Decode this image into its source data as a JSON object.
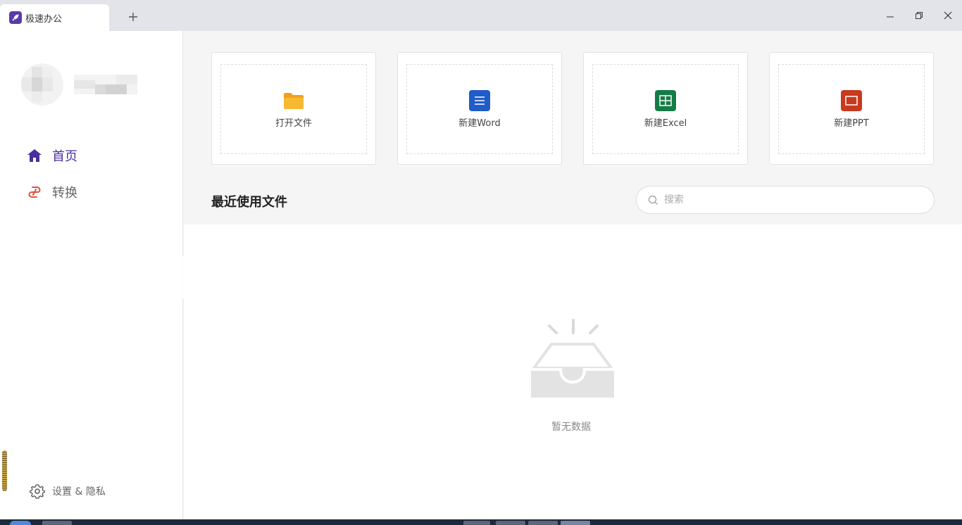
{
  "titlebar": {
    "tab_title": "极速办公",
    "new_tab": "+"
  },
  "sidebar": {
    "nav": [
      {
        "label": "首页",
        "icon": "home-icon",
        "active": true
      },
      {
        "label": "转换",
        "icon": "convert-icon",
        "active": false
      }
    ],
    "settings_label": "设置 & 隐私"
  },
  "actions": [
    {
      "label": "打开文件",
      "icon": "folder-icon",
      "color": "#f5a623"
    },
    {
      "label": "新建Word",
      "icon": "word-doc-icon",
      "color": "#1f5cc7"
    },
    {
      "label": "新建Excel",
      "icon": "excel-sheet-icon",
      "color": "#167c46"
    },
    {
      "label": "新建PPT",
      "icon": "ppt-slide-icon",
      "color": "#c9391d"
    }
  ],
  "recent": {
    "title": "最近使用文件",
    "search_placeholder": "搜索",
    "empty_text": "暂无数据"
  },
  "colors": {
    "accent": "#4a2f9c",
    "titlebar": "#e3e4e9"
  }
}
